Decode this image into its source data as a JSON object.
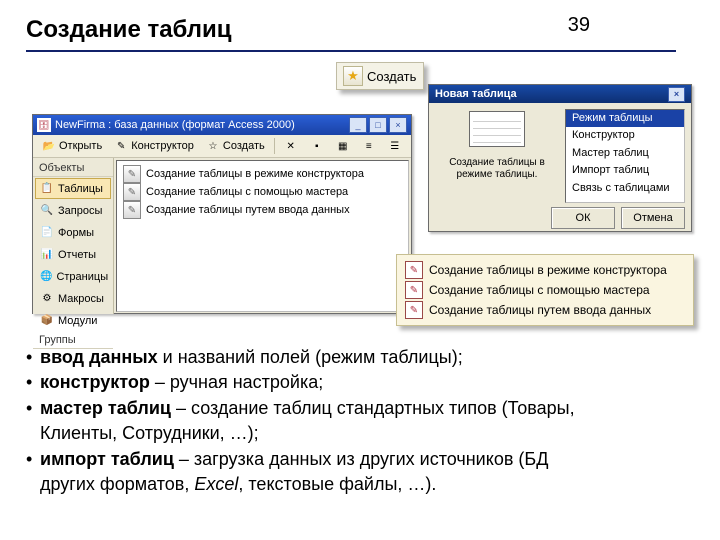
{
  "page_number": "39",
  "title": "Создание таблиц",
  "create_btn": {
    "label": "Создать",
    "underline_letter": "ь"
  },
  "db_window": {
    "title": "NewFirma : база данных (формат Access 2000)",
    "toolbar": {
      "open": "Открыть",
      "design": "Конструктор",
      "create": "Создать"
    },
    "sidebar_heading": "Объекты",
    "sidebar_footer": "Группы",
    "sidebar": [
      {
        "label": "Таблицы",
        "icon": "📋",
        "selected": true
      },
      {
        "label": "Запросы",
        "icon": "🔍",
        "selected": false
      },
      {
        "label": "Формы",
        "icon": "📄",
        "selected": false
      },
      {
        "label": "Отчеты",
        "icon": "📊",
        "selected": false
      },
      {
        "label": "Страницы",
        "icon": "🌐",
        "selected": false
      },
      {
        "label": "Макросы",
        "icon": "⚙",
        "selected": false
      },
      {
        "label": "Модули",
        "icon": "📦",
        "selected": false
      }
    ],
    "list": [
      "Создание таблицы в режиме конструктора",
      "Создание таблицы с помощью мастера",
      "Создание таблицы путем ввода данных"
    ]
  },
  "nt": {
    "title": "Новая таблица",
    "caption": "Создание таблицы в режиме таблицы.",
    "options": [
      "Режим таблицы",
      "Конструктор",
      "Мастер таблиц",
      "Импорт таблиц",
      "Связь с таблицами"
    ],
    "ok": "ОК",
    "cancel": "Отмена"
  },
  "highlight": [
    "Создание таблицы в режиме конструктора",
    "Создание таблицы с помощью мастера",
    "Создание таблицы путем ввода данных"
  ],
  "bullets": {
    "b1_bold": "ввод данных",
    "b1_rest": " и названий полей (режим таблицы);",
    "b2_bold": "конструктор",
    "b2_rest": " – ручная настройка;",
    "b3_bold": "мастер таблиц",
    "b3_rest_a": " – создание таблиц стандартных типов (Товары,",
    "b3_rest_b": "Клиенты, Сотрудники, …);",
    "b4_bold": "импорт таблиц",
    "b4_rest_a": " – загрузка данных из других источников (БД",
    "b4_rest_b_pre": "других форматов, ",
    "b4_rest_b_ital": "Excel",
    "b4_rest_b_post": ", текстовые файлы, …)."
  }
}
